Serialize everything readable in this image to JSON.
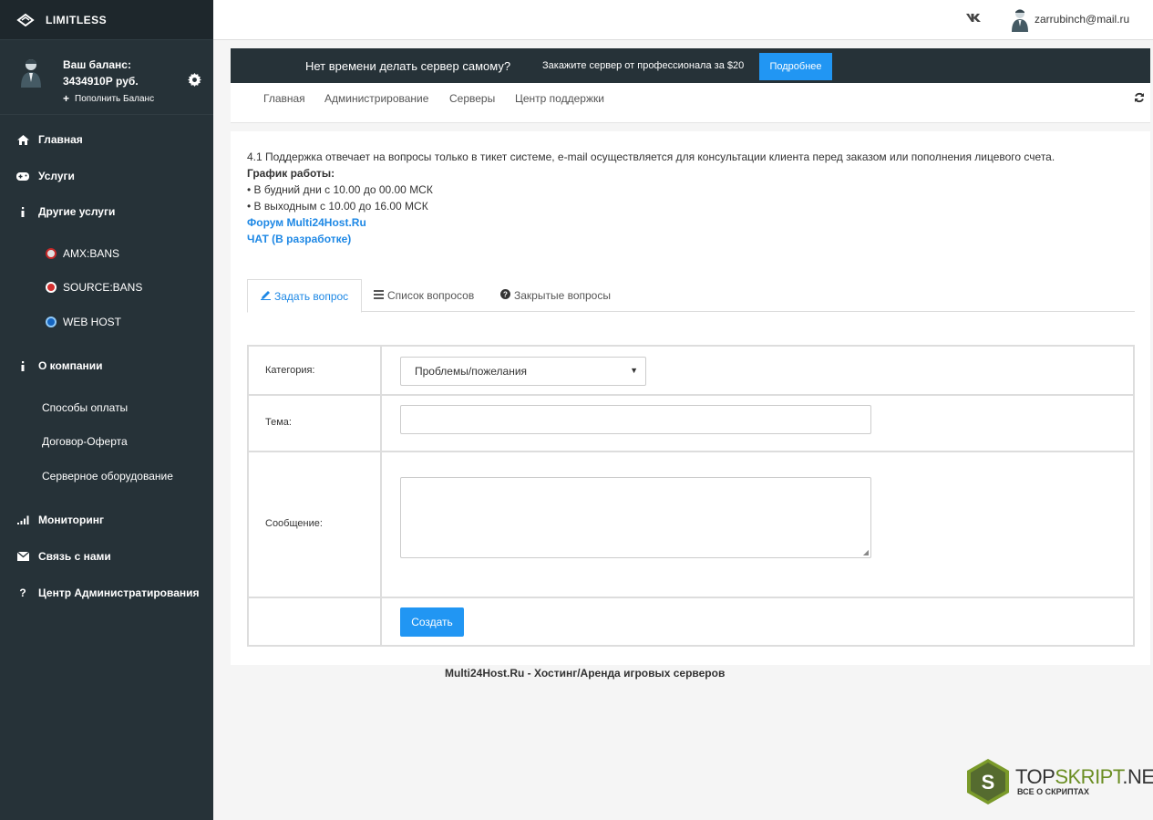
{
  "brand": {
    "name": "LIMITLESS"
  },
  "user": {
    "balance_label": "Ваш баланс:",
    "balance_value": "3434910Р руб.",
    "topup_label": "Пополнить Баланс"
  },
  "nav": {
    "home": "Главная",
    "services": "Услуги",
    "other_services": "Другие услуги",
    "sub_amx": "AMX:BANS",
    "sub_source": "SOURCE:BANS",
    "sub_web": "WEB HOST",
    "about": "О компании",
    "payment": "Способы оплаты",
    "contract": "Договор-Оферта",
    "hardware": "Серверное оборудование",
    "monitoring": "Мониторинг",
    "contact": "Связь с нами",
    "admin_center": "Центр Администратирования"
  },
  "topbar": {
    "vk_label": "vk",
    "email": "zarrubinch@mail.ru"
  },
  "promo": {
    "headline": "Нет времени делать сервер самому?",
    "offer": "Закажите сервер от профессионала за $20",
    "button": "Подробнее"
  },
  "subnav": {
    "items": [
      "Главная",
      "Администрирование",
      "Серверы",
      "Центр поддержки"
    ]
  },
  "info": {
    "line1": "4.1 Поддержка отвечает на вопросы только в тикет системе, e-mail осуществляется для консультации клиента перед заказом или пополнения лицевого счета.",
    "schedule_title": "График работы:",
    "weekdays": "• В будний дни с 10.00 до 00.00 МСК",
    "weekends": "• В выходным с 10.00 до 16.00 МСК",
    "forum_link": "Форум Multi24Host.Ru",
    "chat_link": "ЧАТ (В разработке)"
  },
  "ticket_tabs": {
    "ask": "Задать вопрос",
    "list": "Список вопросов",
    "closed": "Закрытые вопросы"
  },
  "form": {
    "category_label": "Категория:",
    "category_value": "Проблемы/пожелания",
    "subject_label": "Тема:",
    "subject_value": "",
    "message_label": "Сообщение:",
    "message_value": "",
    "submit": "Создать"
  },
  "footer": {
    "text": "Multi24Host.Ru - Хостинг/Аренда игровых серверов"
  },
  "watermark": {
    "text_a": "TOP",
    "text_b": "SKRIPT",
    "text_c": ".NET",
    "tagline": "ВСЕ О СКРИПТАХ",
    "letter": "S"
  },
  "colors": {
    "sidebar": "#263238",
    "accent": "#2196f3",
    "link": "#1e88e5"
  }
}
